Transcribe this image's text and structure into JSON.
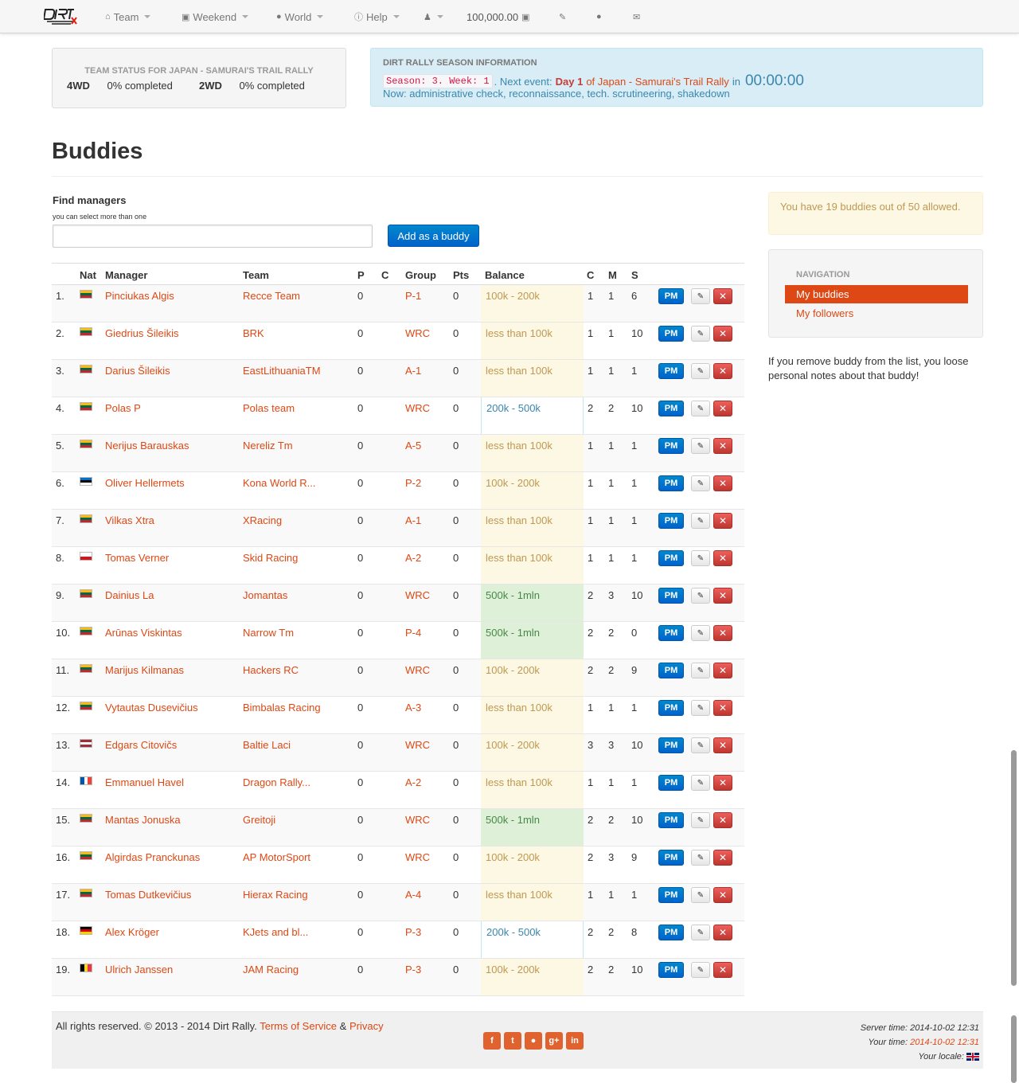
{
  "nav": {
    "team": "Team",
    "weekend": "Weekend",
    "world": "World",
    "help": "Help",
    "balance": "100,000.00"
  },
  "team_status": {
    "header": "TEAM STATUS FOR JAPAN - SAMURAI'S TRAIL RALLY",
    "fwd_label": "4WD",
    "fwd_value": "0% completed",
    "twd_label": "2WD",
    "twd_value": "0% completed"
  },
  "season": {
    "header": "DIRT RALLY SEASON INFORMATION",
    "code": "Season: 3. Week: 1",
    "next_event_text": ". Next event:",
    "day": "Day 1",
    "event": "of Japan - Samurai's Trail Rally",
    "in_text": "in",
    "clock": "00:00:00",
    "now_text": "Now: administrative check, reconnaissance, tech. scrutineering, shakedown"
  },
  "page_title": "Buddies",
  "find": {
    "label": "Find managers",
    "hint": "you can select more than one",
    "button": "Add as a buddy"
  },
  "table": {
    "headers": {
      "nat": "Nat",
      "manager": "Manager",
      "team": "Team",
      "p": "P",
      "c": "C",
      "group": "Group",
      "pts": "Pts",
      "balance": "Balance",
      "c2": "C",
      "m": "M",
      "s": "S"
    },
    "pm_label": "PM",
    "rows": [
      {
        "no": "1.",
        "nat": "lt",
        "manager": "Pinciukas Algis",
        "team": "Recce Team",
        "p": "0",
        "group": "P-1",
        "pts": "0",
        "balance": "100k - 200k",
        "bal_class": "warn",
        "c": "1",
        "m": "1",
        "s": "6"
      },
      {
        "no": "2.",
        "nat": "lt",
        "manager": "Giedrius Šileikis",
        "team": "BRK",
        "p": "0",
        "group": "WRC",
        "pts": "0",
        "balance": "less than 100k",
        "bal_class": "warn",
        "c": "1",
        "m": "1",
        "s": "10"
      },
      {
        "no": "3.",
        "nat": "lt",
        "manager": "Darius Šileikis",
        "team": "EastLithuaniaTM",
        "p": "0",
        "group": "A-1",
        "pts": "0",
        "balance": "less than 100k",
        "bal_class": "warn",
        "c": "1",
        "m": "1",
        "s": "1"
      },
      {
        "no": "4.",
        "nat": "lt",
        "manager": "Polas P",
        "team": "Polas team",
        "p": "0",
        "group": "WRC",
        "pts": "0",
        "balance": "200k - 500k",
        "bal_class": "info",
        "c": "2",
        "m": "2",
        "s": "10"
      },
      {
        "no": "5.",
        "nat": "lt",
        "manager": "Nerijus Barauskas",
        "team": "Nereliz Tm",
        "p": "0",
        "group": "A-5",
        "pts": "0",
        "balance": "less than 100k",
        "bal_class": "warn",
        "c": "1",
        "m": "1",
        "s": "1"
      },
      {
        "no": "6.",
        "nat": "ee",
        "manager": "Oliver Hellermets",
        "team": "Kona World R...",
        "p": "0",
        "group": "P-2",
        "pts": "0",
        "balance": "100k - 200k",
        "bal_class": "warn",
        "c": "1",
        "m": "1",
        "s": "1"
      },
      {
        "no": "7.",
        "nat": "lt",
        "manager": "Vilkas Xtra",
        "team": "XRacing",
        "p": "0",
        "group": "A-1",
        "pts": "0",
        "balance": "less than 100k",
        "bal_class": "warn",
        "c": "1",
        "m": "1",
        "s": "1"
      },
      {
        "no": "8.",
        "nat": "cz",
        "manager": "Tomas Verner",
        "team": "Skid Racing",
        "p": "0",
        "group": "A-2",
        "pts": "0",
        "balance": "less than 100k",
        "bal_class": "warn",
        "c": "1",
        "m": "1",
        "s": "1"
      },
      {
        "no": "9.",
        "nat": "lt",
        "manager": "Dainius La",
        "team": "Jomantas",
        "p": "0",
        "group": "WRC",
        "pts": "0",
        "balance": "500k - 1mln",
        "bal_class": "success",
        "c": "2",
        "m": "3",
        "s": "10"
      },
      {
        "no": "10.",
        "nat": "lt",
        "manager": "Arūnas Viskintas",
        "team": "Narrow Tm",
        "p": "0",
        "group": "P-4",
        "pts": "0",
        "balance": "500k - 1mln",
        "bal_class": "success",
        "c": "2",
        "m": "2",
        "s": "0"
      },
      {
        "no": "11.",
        "nat": "lt",
        "manager": "Marijus Kilmanas",
        "team": "Hackers RC",
        "p": "0",
        "group": "WRC",
        "pts": "0",
        "balance": "100k - 200k",
        "bal_class": "warn",
        "c": "2",
        "m": "2",
        "s": "9"
      },
      {
        "no": "12.",
        "nat": "lt",
        "manager": "Vytautas Dusevičius",
        "team": "Bimbalas Racing",
        "p": "0",
        "group": "A-3",
        "pts": "0",
        "balance": "less than 100k",
        "bal_class": "warn",
        "c": "1",
        "m": "1",
        "s": "1"
      },
      {
        "no": "13.",
        "nat": "lv",
        "manager": "Edgars Citovičs",
        "team": "Baltie Laci",
        "p": "0",
        "group": "WRC",
        "pts": "0",
        "balance": "100k - 200k",
        "bal_class": "warn",
        "c": "3",
        "m": "3",
        "s": "10"
      },
      {
        "no": "14.",
        "nat": "fr",
        "manager": "Emmanuel Havel",
        "team": "Dragon Rally...",
        "p": "0",
        "group": "A-2",
        "pts": "0",
        "balance": "less than 100k",
        "bal_class": "warn",
        "c": "1",
        "m": "1",
        "s": "1"
      },
      {
        "no": "15.",
        "nat": "lt",
        "manager": "Mantas Jonuska",
        "team": "Greitoji",
        "p": "0",
        "group": "WRC",
        "pts": "0",
        "balance": "500k - 1mln",
        "bal_class": "success",
        "c": "2",
        "m": "2",
        "s": "10"
      },
      {
        "no": "16.",
        "nat": "lt",
        "manager": "Algirdas Pranckunas",
        "team": "AP MotorSport",
        "p": "0",
        "group": "WRC",
        "pts": "0",
        "balance": "100k - 200k",
        "bal_class": "warn",
        "c": "2",
        "m": "3",
        "s": "9"
      },
      {
        "no": "17.",
        "nat": "lt",
        "manager": "Tomas Dutkevičius",
        "team": "Hierax Racing",
        "p": "0",
        "group": "A-4",
        "pts": "0",
        "balance": "less than 100k",
        "bal_class": "warn",
        "c": "1",
        "m": "1",
        "s": "1"
      },
      {
        "no": "18.",
        "nat": "de",
        "manager": "Alex Kröger",
        "team": "KJets and bl...",
        "p": "0",
        "group": "P-3",
        "pts": "0",
        "balance": "200k - 500k",
        "bal_class": "info",
        "c": "2",
        "m": "2",
        "s": "8"
      },
      {
        "no": "19.",
        "nat": "be",
        "manager": "Ulrich Janssen",
        "team": "JAM Racing",
        "p": "0",
        "group": "P-3",
        "pts": "0",
        "balance": "100k - 200k",
        "bal_class": "warn",
        "c": "2",
        "m": "2",
        "s": "10"
      }
    ]
  },
  "flags": {
    "lt": {
      "dir": "h",
      "colors": [
        "#fdb913",
        "#006a44",
        "#c1272d"
      ]
    },
    "ee": {
      "dir": "h",
      "colors": [
        "#0072ce",
        "#000000",
        "#ffffff"
      ]
    },
    "cz": {
      "dir": "h",
      "colors": [
        "#ffffff",
        "#d7141a"
      ]
    },
    "lv": {
      "dir": "h",
      "colors": [
        "#9e3039",
        "#ffffff",
        "#9e3039"
      ]
    },
    "fr": {
      "dir": "v",
      "colors": [
        "#0055a4",
        "#ffffff",
        "#ef4135"
      ]
    },
    "de": {
      "dir": "h",
      "colors": [
        "#000000",
        "#dd0000",
        "#ffce00"
      ]
    },
    "be": {
      "dir": "v",
      "colors": [
        "#000000",
        "#fdda24",
        "#ef3340"
      ]
    }
  },
  "sidebar": {
    "buddy_count": "You have 19 buddies out of 50 allowed.",
    "nav_header": "NAVIGATION",
    "my_buddies": "My buddies",
    "my_followers": "My followers",
    "note": "If you remove buddy from the list, you loose personal notes about that buddy!"
  },
  "footer": {
    "copyright": "All rights reserved. © 2013 - 2014 Dirt Rally.",
    "terms": "Terms of Service",
    "amp": "&",
    "privacy": "Privacy",
    "server_time_label": "Server time:",
    "server_time": "2014-10-02 12:31",
    "your_time_label": "Your time:",
    "your_time": "2014-10-02 12:31",
    "locale_label": "Your locale:"
  }
}
